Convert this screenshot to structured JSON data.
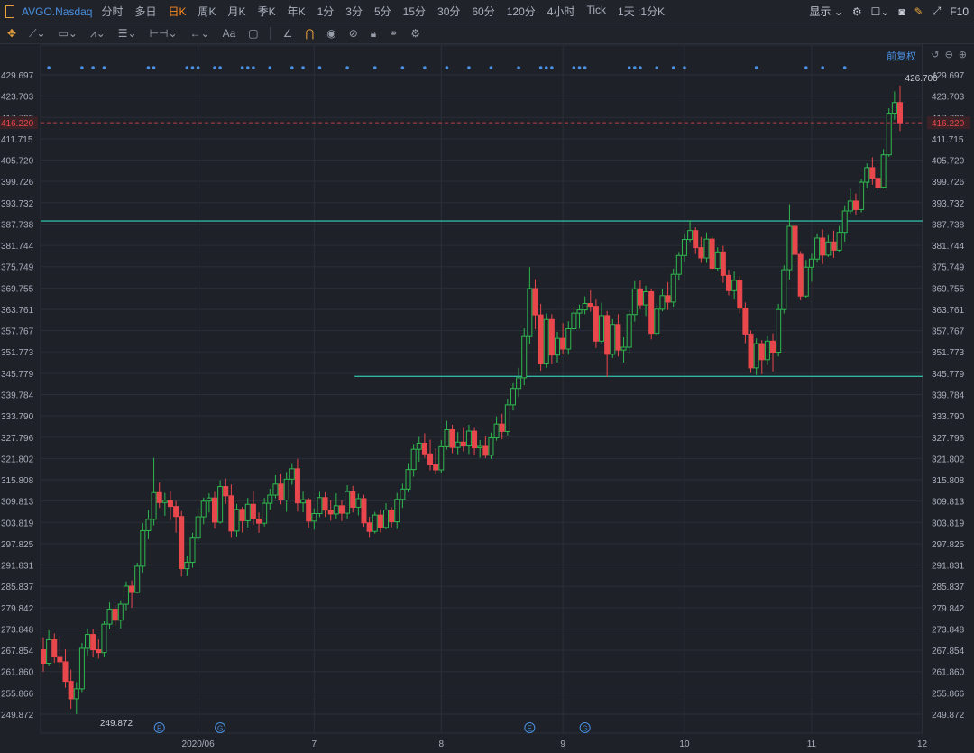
{
  "toolbar": {
    "symbol": "AVGO.Nasdaq",
    "periods": [
      "分时",
      "多日",
      "日K",
      "周K",
      "月K",
      "季K",
      "年K",
      "1分",
      "3分",
      "5分",
      "15分",
      "30分",
      "60分",
      "120分",
      "4小时",
      "Tick",
      "1天 :1分K"
    ],
    "active_period": "日K",
    "display_label": "显示",
    "f10_label": "F10"
  },
  "drawing_tools": [
    "move-tool",
    "line-tool",
    "rect-tool",
    "pattern-tool",
    "fib-tool",
    "range-tool",
    "arrow-tool",
    "text-tool",
    "note-tool",
    "ruler-tool",
    "magnet-tool",
    "eye-tool",
    "hide-tool",
    "lock-tool",
    "link-tool",
    "settings-tool"
  ],
  "adjust_label": "前复权",
  "price_tags": {
    "current": "416.220",
    "high": "426.700",
    "low": "249.872"
  },
  "colors": {
    "up": "#2fb84f",
    "down": "#e8474c",
    "line": "#2fb5a2",
    "axis_text": "#aab0bd",
    "grid": "#2a2e37",
    "current_price": "#e8474c"
  },
  "chart_data": {
    "type": "candlestick",
    "symbol": "AVGO.Nasdaq",
    "period": "日K",
    "ylim": [
      249.872,
      429.697
    ],
    "y_ticks": [
      "429.697",
      "423.703",
      "417.709",
      "411.715",
      "405.720",
      "399.726",
      "393.732",
      "387.738",
      "381.744",
      "375.749",
      "369.755",
      "363.761",
      "357.767",
      "351.773",
      "345.779",
      "339.784",
      "333.790",
      "327.796",
      "321.802",
      "315.808",
      "309.813",
      "303.819",
      "297.825",
      "291.831",
      "285.837",
      "279.842",
      "273.848",
      "267.854",
      "261.860",
      "255.866",
      "249.872"
    ],
    "x_ticks": [
      {
        "label": "2020/06",
        "day": 28
      },
      {
        "label": "7",
        "day": 49
      },
      {
        "label": "8",
        "day": 72
      },
      {
        "label": "9",
        "day": 94
      },
      {
        "label": "10",
        "day": 116
      },
      {
        "label": "11",
        "day": 139
      },
      {
        "label": "12",
        "day": 159
      }
    ],
    "current_price": 416.22,
    "high_marker": {
      "label": "426.700",
      "day": 159
    },
    "low_marker": {
      "label": "249.872",
      "day": 7
    },
    "horizontal_lines": [
      {
        "value": 388.6,
        "from_day": 0
      },
      {
        "value": 344.9,
        "from_day": 56
      }
    ],
    "event_icons": [
      {
        "symbol": "E",
        "day": 21
      },
      {
        "symbol": "G",
        "day": 32
      },
      {
        "symbol": "E",
        "day": 88
      },
      {
        "symbol": "G",
        "day": 98
      }
    ],
    "top_dot_days": [
      1,
      7,
      9,
      11,
      19,
      20,
      26,
      27,
      28,
      31,
      32,
      36,
      37,
      38,
      41,
      45,
      47,
      50,
      55,
      60,
      65,
      69,
      73,
      77,
      81,
      86,
      90,
      91,
      92,
      96,
      97,
      98,
      106,
      107,
      108,
      111,
      114,
      116,
      129,
      138,
      141,
      145
    ],
    "ohlc": [
      [
        268.0,
        271.5,
        261.8,
        264.2
      ],
      [
        264.2,
        273.5,
        263.5,
        270.8
      ],
      [
        270.8,
        272.6,
        264.3,
        266.1
      ],
      [
        266.1,
        271.8,
        263.0,
        264.6
      ],
      [
        264.6,
        268.1,
        257.3,
        259.1
      ],
      [
        259.1,
        262.4,
        251.4,
        254.2
      ],
      [
        254.2,
        258.9,
        249.9,
        257.0
      ],
      [
        257.0,
        269.9,
        256.1,
        268.4
      ],
      [
        268.4,
        274.0,
        266.4,
        272.3
      ],
      [
        272.3,
        273.8,
        265.9,
        268.0
      ],
      [
        268.0,
        270.9,
        265.5,
        267.2
      ],
      [
        267.2,
        276.0,
        266.1,
        275.2
      ],
      [
        275.2,
        281.3,
        273.8,
        279.4
      ],
      [
        279.4,
        280.6,
        274.9,
        276.3
      ],
      [
        276.3,
        281.9,
        274.0,
        280.8
      ],
      [
        280.8,
        287.2,
        279.1,
        285.9
      ],
      [
        285.9,
        287.5,
        279.8,
        284.1
      ],
      [
        284.1,
        292.5,
        283.9,
        291.5
      ],
      [
        291.5,
        303.6,
        289.7,
        301.5
      ],
      [
        301.5,
        307.3,
        299.1,
        304.7
      ],
      [
        304.7,
        322.0,
        303.0,
        312.2
      ],
      [
        312.2,
        315.0,
        307.9,
        309.4
      ],
      [
        309.4,
        312.1,
        305.7,
        310.0
      ],
      [
        310.0,
        312.6,
        304.5,
        308.3
      ],
      [
        308.3,
        309.9,
        300.9,
        305.5
      ],
      [
        305.5,
        307.0,
        288.6,
        290.8
      ],
      [
        290.8,
        294.3,
        288.7,
        292.6
      ],
      [
        292.6,
        300.9,
        291.1,
        299.4
      ],
      [
        299.4,
        307.8,
        298.3,
        305.4
      ],
      [
        305.4,
        310.8,
        303.3,
        309.8
      ],
      [
        309.8,
        312.0,
        306.6,
        310.7
      ],
      [
        310.7,
        312.4,
        302.1,
        303.9
      ],
      [
        303.9,
        315.7,
        303.5,
        313.9
      ],
      [
        313.9,
        316.2,
        309.0,
        311.3
      ],
      [
        311.3,
        314.5,
        299.5,
        301.4
      ],
      [
        301.4,
        309.0,
        299.8,
        307.5
      ],
      [
        307.5,
        308.2,
        301.0,
        304.3
      ],
      [
        304.3,
        310.7,
        302.4,
        308.9
      ],
      [
        308.9,
        312.7,
        303.1,
        304.8
      ],
      [
        304.8,
        306.6,
        300.9,
        303.6
      ],
      [
        303.6,
        310.7,
        302.7,
        309.2
      ],
      [
        309.2,
        313.3,
        307.4,
        311.5
      ],
      [
        311.5,
        317.1,
        310.6,
        314.6
      ],
      [
        314.6,
        317.4,
        308.9,
        310.1
      ],
      [
        310.1,
        318.0,
        306.8,
        316.0
      ],
      [
        316.0,
        320.5,
        314.4,
        318.9
      ],
      [
        318.9,
        321.7,
        306.9,
        309.3
      ],
      [
        309.3,
        312.5,
        306.7,
        310.2
      ],
      [
        310.2,
        310.7,
        302.3,
        304.2
      ],
      [
        304.2,
        307.8,
        301.8,
        306.3
      ],
      [
        306.3,
        312.4,
        305.3,
        310.8
      ],
      [
        310.8,
        312.3,
        305.4,
        307.3
      ],
      [
        307.3,
        310.1,
        304.3,
        306.2
      ],
      [
        306.2,
        312.0,
        304.9,
        308.5
      ],
      [
        308.5,
        310.0,
        304.2,
        306.4
      ],
      [
        306.4,
        314.3,
        304.8,
        312.5
      ],
      [
        312.5,
        314.1,
        306.6,
        308.1
      ],
      [
        308.1,
        311.9,
        305.8,
        310.5
      ],
      [
        310.5,
        311.6,
        302.6,
        303.7
      ],
      [
        303.7,
        305.4,
        299.5,
        301.3
      ],
      [
        301.3,
        306.8,
        300.7,
        305.9
      ],
      [
        305.9,
        307.4,
        301.0,
        302.4
      ],
      [
        302.4,
        309.2,
        301.9,
        307.3
      ],
      [
        307.3,
        308.1,
        302.4,
        304.0
      ],
      [
        304.0,
        312.1,
        302.0,
        310.3
      ],
      [
        310.3,
        314.7,
        307.9,
        313.2
      ],
      [
        313.2,
        320.5,
        312.3,
        318.7
      ],
      [
        318.7,
        325.9,
        316.7,
        324.4
      ],
      [
        324.4,
        327.9,
        320.9,
        326.1
      ],
      [
        326.1,
        328.9,
        322.0,
        323.1
      ],
      [
        323.1,
        327.1,
        318.5,
        320.0
      ],
      [
        320.0,
        324.7,
        317.3,
        318.6
      ],
      [
        318.6,
        327.0,
        317.7,
        325.1
      ],
      [
        325.1,
        332.4,
        324.3,
        329.9
      ],
      [
        329.9,
        331.3,
        323.3,
        324.9
      ],
      [
        324.9,
        329.2,
        323.0,
        326.4
      ],
      [
        326.4,
        330.4,
        323.8,
        325.3
      ],
      [
        325.3,
        331.3,
        323.1,
        329.5
      ],
      [
        329.5,
        330.4,
        322.8,
        324.8
      ],
      [
        324.8,
        327.0,
        322.0,
        325.2
      ],
      [
        325.2,
        328.1,
        321.9,
        322.7
      ],
      [
        322.7,
        329.1,
        321.7,
        327.6
      ],
      [
        327.6,
        333.6,
        326.8,
        331.5
      ],
      [
        331.5,
        334.4,
        327.2,
        329.4
      ],
      [
        329.4,
        338.5,
        328.3,
        336.9
      ],
      [
        336.9,
        343.0,
        335.3,
        341.5
      ],
      [
        341.5,
        347.3,
        339.1,
        344.5
      ],
      [
        344.5,
        358.4,
        342.4,
        356.1
      ],
      [
        356.1,
        375.6,
        354.0,
        369.6
      ],
      [
        369.6,
        372.2,
        358.2,
        362.2
      ],
      [
        362.2,
        365.3,
        346.5,
        348.4
      ],
      [
        348.4,
        362.6,
        347.3,
        360.9
      ],
      [
        360.9,
        362.4,
        348.3,
        350.9
      ],
      [
        350.9,
        357.4,
        348.8,
        355.6
      ],
      [
        355.6,
        359.9,
        351.1,
        352.6
      ],
      [
        352.6,
        360.4,
        351.0,
        358.3
      ],
      [
        358.3,
        364.5,
        357.5,
        362.7
      ],
      [
        362.7,
        365.1,
        358.3,
        363.6
      ],
      [
        363.6,
        367.4,
        362.4,
        365.4
      ],
      [
        365.4,
        369.1,
        363.1,
        364.6
      ],
      [
        364.6,
        366.5,
        352.9,
        354.8
      ],
      [
        354.8,
        365.6,
        354.2,
        362.0
      ],
      [
        362.0,
        363.3,
        344.7,
        351.1
      ],
      [
        351.1,
        361.0,
        350.1,
        359.5
      ],
      [
        359.5,
        362.4,
        350.5,
        352.3
      ],
      [
        352.3,
        355.9,
        348.8,
        353.1
      ],
      [
        353.1,
        363.5,
        351.4,
        362.3
      ],
      [
        362.3,
        371.7,
        360.3,
        369.5
      ],
      [
        369.5,
        371.9,
        363.8,
        365.0
      ],
      [
        365.0,
        370.4,
        361.9,
        368.7
      ],
      [
        368.7,
        369.6,
        355.3,
        357.0
      ],
      [
        357.0,
        365.4,
        356.2,
        363.8
      ],
      [
        363.8,
        369.4,
        363.2,
        367.6
      ],
      [
        367.6,
        371.4,
        363.6,
        365.8
      ],
      [
        365.8,
        375.2,
        364.5,
        373.6
      ],
      [
        373.6,
        379.9,
        372.0,
        378.9
      ],
      [
        378.9,
        385.0,
        377.2,
        383.4
      ],
      [
        383.4,
        388.8,
        382.7,
        385.9
      ],
      [
        385.9,
        386.8,
        379.3,
        381.1
      ],
      [
        381.1,
        384.1,
        376.8,
        378.2
      ],
      [
        378.2,
        385.4,
        376.8,
        383.5
      ],
      [
        383.5,
        384.3,
        374.3,
        375.3
      ],
      [
        375.3,
        381.2,
        374.7,
        379.9
      ],
      [
        379.9,
        381.6,
        371.2,
        373.3
      ],
      [
        373.3,
        374.9,
        367.7,
        369.0
      ],
      [
        369.0,
        374.4,
        366.5,
        371.9
      ],
      [
        371.9,
        373.1,
        362.6,
        364.1
      ],
      [
        364.1,
        365.7,
        354.2,
        356.8
      ],
      [
        356.8,
        357.8,
        345.9,
        347.3
      ],
      [
        347.3,
        355.6,
        345.3,
        354.1
      ],
      [
        354.1,
        355.1,
        345.5,
        349.6
      ],
      [
        349.6,
        356.2,
        348.1,
        354.8
      ],
      [
        354.8,
        357.0,
        346.3,
        351.7
      ],
      [
        351.7,
        365.3,
        350.5,
        363.7
      ],
      [
        363.7,
        376.1,
        362.6,
        374.9
      ],
      [
        374.9,
        393.3,
        372.1,
        387.1
      ],
      [
        387.1,
        387.8,
        377.0,
        379.2
      ],
      [
        379.2,
        380.1,
        366.3,
        367.5
      ],
      [
        367.5,
        377.6,
        366.9,
        375.6
      ],
      [
        375.6,
        379.4,
        371.5,
        377.9
      ],
      [
        377.9,
        385.1,
        376.9,
        383.8
      ],
      [
        383.8,
        386.2,
        376.5,
        379.0
      ],
      [
        379.0,
        384.6,
        378.5,
        382.7
      ],
      [
        382.7,
        385.9,
        378.2,
        380.4
      ],
      [
        380.4,
        387.2,
        380.0,
        385.4
      ],
      [
        385.4,
        393.0,
        382.8,
        391.4
      ],
      [
        391.4,
        397.6,
        390.6,
        394.2
      ],
      [
        394.2,
        396.3,
        390.4,
        391.8
      ],
      [
        391.8,
        400.4,
        391.0,
        399.5
      ],
      [
        399.5,
        404.8,
        397.8,
        403.6
      ],
      [
        403.6,
        406.5,
        398.8,
        400.6
      ],
      [
        400.6,
        404.3,
        396.2,
        398.1
      ],
      [
        398.1,
        408.8,
        397.8,
        407.2
      ],
      [
        407.2,
        420.3,
        406.6,
        418.9
      ],
      [
        418.9,
        425.0,
        417.0,
        421.9
      ],
      [
        421.9,
        426.7,
        413.9,
        416.2
      ]
    ]
  }
}
